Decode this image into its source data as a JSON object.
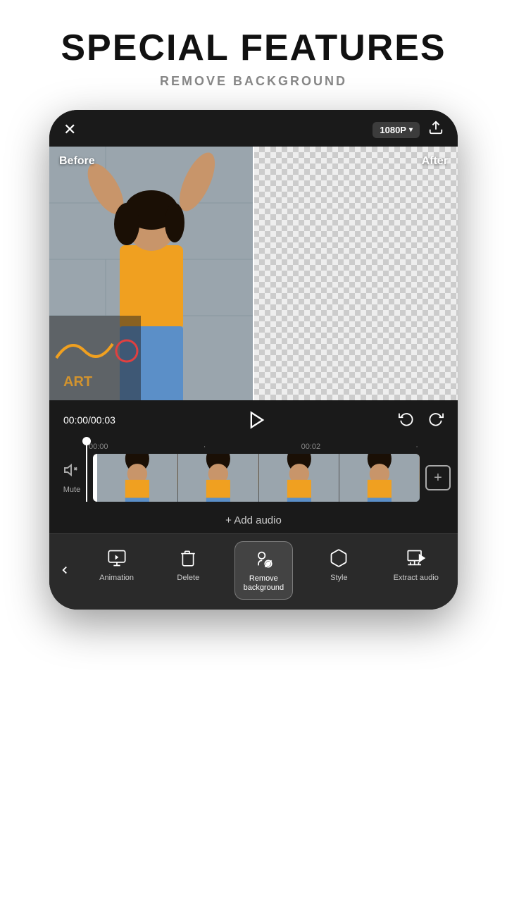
{
  "header": {
    "title": "SPECIAL FEATURES",
    "subtitle": "REMOVE BACKGROUND"
  },
  "phone": {
    "topbar": {
      "close_label": "✕",
      "resolution": "1080P",
      "upload_icon": "upload-icon"
    },
    "preview": {
      "before_label": "Before",
      "after_label": "After"
    },
    "controls": {
      "time_current": "00:00",
      "time_total": "00:03",
      "time_display": "00:00/00:03"
    },
    "timeline": {
      "markers": [
        "00:00",
        "00:02"
      ],
      "mute_label": "Mute"
    },
    "add_audio_label": "+ Add audio",
    "toolbar": {
      "back_icon": "chevron-left-icon",
      "items": [
        {
          "id": "animation",
          "label": "Animation",
          "icon": "animation-icon"
        },
        {
          "id": "delete",
          "label": "Delete",
          "icon": "delete-icon"
        },
        {
          "id": "remove-background",
          "label": "Remove background",
          "icon": "remove-bg-icon",
          "active": true
        },
        {
          "id": "style",
          "label": "Style",
          "icon": "style-icon"
        },
        {
          "id": "extract-audio",
          "label": "Extract audio",
          "icon": "extract-audio-icon"
        }
      ]
    }
  }
}
